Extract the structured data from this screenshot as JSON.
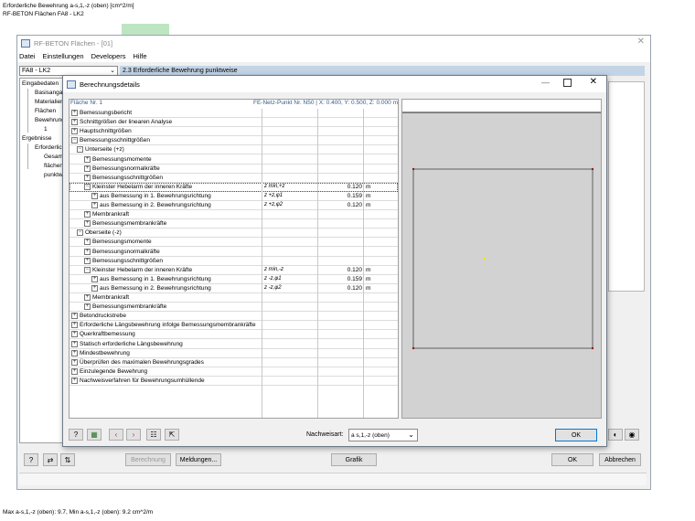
{
  "header": {
    "line1": "Erforderliche Bewehrung a-s,1,-z (oben) [cm^2/m]",
    "line2": "RF-BETON Flächen FA8 - LK2"
  },
  "footer_text": "Max a-s,1,-z (oben): 9.7, Min a-s,1,-z (oben): 9.2 cm^2/m",
  "main_window": {
    "title": "RF-BETON Flächen - [01]",
    "menu": [
      "Datei",
      "Einstellungen",
      "Developers",
      "Hilfe"
    ],
    "case_select": "FA8 - LK2",
    "section_title": "2.3 Erforderliche Bewehrung punktweise",
    "nav": [
      "Eingabedaten",
      "Basisangab",
      "Materialien",
      "Flächen",
      "Bewehrung",
      "1",
      "Ergebnisse",
      "Erforderlic",
      "Gesam",
      "flächen",
      "punktw"
    ],
    "buttons": {
      "calc": "Berechnung",
      "messages": "Meldungen...",
      "graphic": "Grafik",
      "ok": "OK",
      "cancel": "Abbrechen"
    }
  },
  "dialog": {
    "title": "Berechnungsdetails",
    "info_left": "Fläche Nr. 1",
    "info_right": "FE-Netz-Punkt Nr. N50  |  X: 0.400, Y: 0.500, Z: 0.000 m",
    "tree": [
      {
        "label": "Bemessungsbericht",
        "level": 0,
        "exp": "+"
      },
      {
        "label": "Schnittgrößen der linearen Analyse",
        "level": 0,
        "exp": "+"
      },
      {
        "label": "Hauptschnittgrößen",
        "level": 0,
        "exp": "+"
      },
      {
        "label": "Bemessungsschnittgrößen",
        "level": 0,
        "exp": "-"
      },
      {
        "label": "Unterseite (+z)",
        "level": 1,
        "exp": "-"
      },
      {
        "label": "Bemessungsmomente",
        "level": 2,
        "exp": "+"
      },
      {
        "label": "Bemessungsnormalkräfte",
        "level": 2,
        "exp": "+"
      },
      {
        "label": "Bemessungsschnittgrößen",
        "level": 2,
        "exp": "+"
      },
      {
        "label": "Kleinster Hebelarm der inneren Kräfte",
        "level": 2,
        "exp": "-",
        "sym": "z min,+z",
        "val": "0.120",
        "unit": "m",
        "selected": true
      },
      {
        "label": "aus Bemessung in 1. Bewehrungsrichtung",
        "level": 3,
        "exp": "+",
        "sym": "z +z,φ1",
        "val": "0.159",
        "unit": "m"
      },
      {
        "label": "aus Bemessung in 2. Bewehrungsrichtung",
        "level": 3,
        "exp": "+",
        "sym": "z +z,φ2",
        "val": "0.120",
        "unit": "m"
      },
      {
        "label": "Membrankraft",
        "level": 2,
        "exp": "+"
      },
      {
        "label": "Bemessungsmembrankräfte",
        "level": 2,
        "exp": "+"
      },
      {
        "label": "Oberseite (-z)",
        "level": 1,
        "exp": "-"
      },
      {
        "label": "Bemessungsmomente",
        "level": 2,
        "exp": "+"
      },
      {
        "label": "Bemessungsnormalkräfte",
        "level": 2,
        "exp": "+"
      },
      {
        "label": "Bemessungsschnittgrößen",
        "level": 2,
        "exp": "+"
      },
      {
        "label": "Kleinster Hebelarm der inneren Kräfte",
        "level": 2,
        "exp": "-",
        "sym": "z min,-z",
        "val": "0.120",
        "unit": "m"
      },
      {
        "label": "aus Bemessung in 1. Bewehrungsrichtung",
        "level": 3,
        "exp": "+",
        "sym": "z -z,φ1",
        "val": "0.159",
        "unit": "m"
      },
      {
        "label": "aus Bemessung in 2. Bewehrungsrichtung",
        "level": 3,
        "exp": "+",
        "sym": "z -z,φ2",
        "val": "0.120",
        "unit": "m"
      },
      {
        "label": "Membrankraft",
        "level": 2,
        "exp": "+"
      },
      {
        "label": "Bemessungsmembrankräfte",
        "level": 2,
        "exp": "+"
      },
      {
        "label": "Betondruckstrebe",
        "level": 0,
        "exp": "+"
      },
      {
        "label": "Erforderliche Längsbewehrung infolge Bemessungsmembrankräfte",
        "level": 0,
        "exp": "+"
      },
      {
        "label": "Querkraftbemessung",
        "level": 0,
        "exp": "+"
      },
      {
        "label": "Statisch erforderliche Längsbewehrung",
        "level": 0,
        "exp": "+"
      },
      {
        "label": "Mindestbewehrung",
        "level": 0,
        "exp": "+"
      },
      {
        "label": "Überprüfen des maximalen Bewehrungsgrades",
        "level": 0,
        "exp": "+"
      },
      {
        "label": "Einzulegende Bewehrung",
        "level": 0,
        "exp": "+"
      },
      {
        "label": "Nachweisverfahren für Bewehrungsumhüllende",
        "level": 0,
        "exp": "+"
      }
    ],
    "nachweisart_label": "Nachweisart:",
    "nachweisart_value": "a s,1,-z (oben)",
    "ok": "OK"
  }
}
